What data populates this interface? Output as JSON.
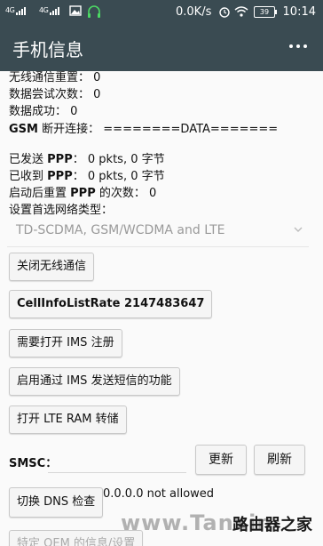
{
  "status_bar": {
    "network_1": "4G",
    "network_2": "4G",
    "speed": "0.0K/s",
    "battery": "39",
    "time": "10:14"
  },
  "app_bar": {
    "title": "手机信息",
    "menu_icon": "more-vert-icon"
  },
  "info_lines": {
    "radio_reset_label": "无线通信重置：",
    "radio_reset_value": "0",
    "data_attempts_label": "数据尝试次数：",
    "data_attempts_value": "0",
    "data_success_label": "数据成功：",
    "data_success_value": "0",
    "gsm_disconnect_label": "GSM",
    "gsm_disconnect_label2": "断开连接：",
    "gsm_disconnect_value": "========DATA=======",
    "ppp_sent_label1": "已发送",
    "ppp_sent_label2": "PPP",
    "ppp_sent_value": "0 pkts, 0 字节",
    "ppp_recv_label1": "已收到",
    "ppp_recv_label2": "PPP",
    "ppp_recv_value": "0 pkts, 0 字节",
    "ppp_reset_label1": "启动后重置",
    "ppp_reset_label2": "PPP",
    "ppp_reset_label3": "的次数：",
    "ppp_reset_value": "0",
    "network_type_label": "设置首选网络类型："
  },
  "network_type_select": {
    "selected": "TD-SCDMA, GSM/WCDMA and LTE"
  },
  "buttons": {
    "radio_off": "关闭无线通信",
    "cellinfo": "CellInfoListRate 2147483647",
    "ims_reg": "需要打开 IMS 注册",
    "ims_sms": "启用通过 IMS 发送短信的功能",
    "lte_ram": "打开 LTE RAM 转储",
    "update": "更新",
    "refresh": "刷新",
    "dns": "切换 DNS 检查",
    "oem": "特定 OEM 的信息/设置"
  },
  "smsc": {
    "label": "SMSC：",
    "value": ""
  },
  "dns_result": "0.0.0.0 not allowed",
  "watermark": {
    "text": "www.Tanxin",
    "text2": "路由器之家"
  },
  "colors": {
    "bar": "#3a4b52",
    "button_bg": "#f5f5f5",
    "muted": "#9a9a9a"
  }
}
